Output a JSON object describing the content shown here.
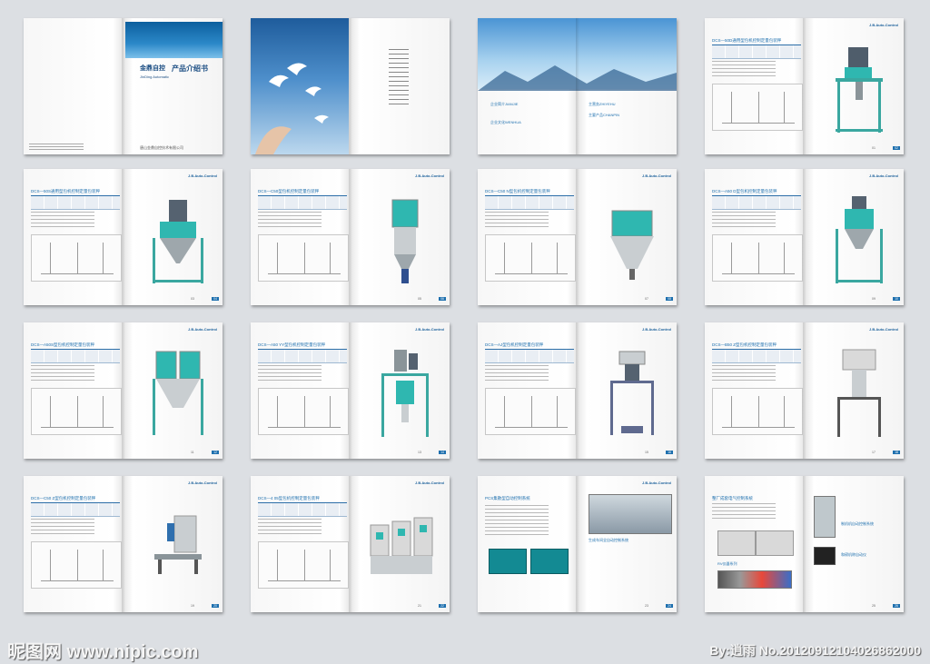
{
  "brand": "J.B.Auto-Control",
  "cover": {
    "logo": "金鼎自控",
    "title": "产品介绍书",
    "subtitle": "JinDing Automatic",
    "company": "唐山金鼎自控技术有限公司"
  },
  "intro": {
    "h1": "企业简介JIANJIE",
    "h2": "主营务ZHIYEHU",
    "h3": "主要产品CHANPIN",
    "h4": "企业文化WENHUA"
  },
  "products": [
    {
      "title": "DCS—50D通用型包机控制定量包装秤",
      "left": "01",
      "right": "02"
    },
    {
      "title": "DCS—50S通用型包机控制定量包装秤",
      "left": "03",
      "right": "04"
    },
    {
      "title": "DCS—C50型包机控制定量包装秤",
      "left": "05",
      "right": "06"
    },
    {
      "title": "DCS—C50 N型包机控制定量包装秤",
      "left": "07",
      "right": "08"
    },
    {
      "title": "DCS—A50 D型包机控制定量包装秤",
      "left": "09",
      "right": "10"
    },
    {
      "title": "DCS—A50S型包机控制定量包装秤",
      "left": "11",
      "right": "12"
    },
    {
      "title": "DCS—A50 YY型包机控制定量包装秤",
      "left": "13",
      "right": "14"
    },
    {
      "title": "DCS—AJ型包机控制定量包装秤",
      "left": "15",
      "right": "16"
    },
    {
      "title": "DCS—B50 Z型包机控制定量包装秤",
      "left": "17",
      "right": "18"
    },
    {
      "title": "DCS—C50 Z型包机控制定量包装秤",
      "left": "19",
      "right": "20"
    },
    {
      "title": "DCS—4 05型包机控制定量包装秤",
      "left": "21",
      "right": "22"
    }
  ],
  "plc": {
    "title": "PCS集散型自动控制系统",
    "caption": "生成车间全自动控制系统",
    "left": "23",
    "right": "24"
  },
  "elec": {
    "title": "整厂成套电气控制系统",
    "c1": "制机机自动控制系统",
    "c2": "RV仪器系列",
    "c3": "和磅机称自动仪",
    "left": "25",
    "right": "26"
  },
  "watermark": {
    "site": "昵图网 www.nipic.com",
    "author": "By:逍雨 No.20120912104026862000"
  },
  "colors": {
    "accent": "#1d6fae",
    "machine": "#2fb7b0",
    "frame": "#3aa7a0"
  }
}
